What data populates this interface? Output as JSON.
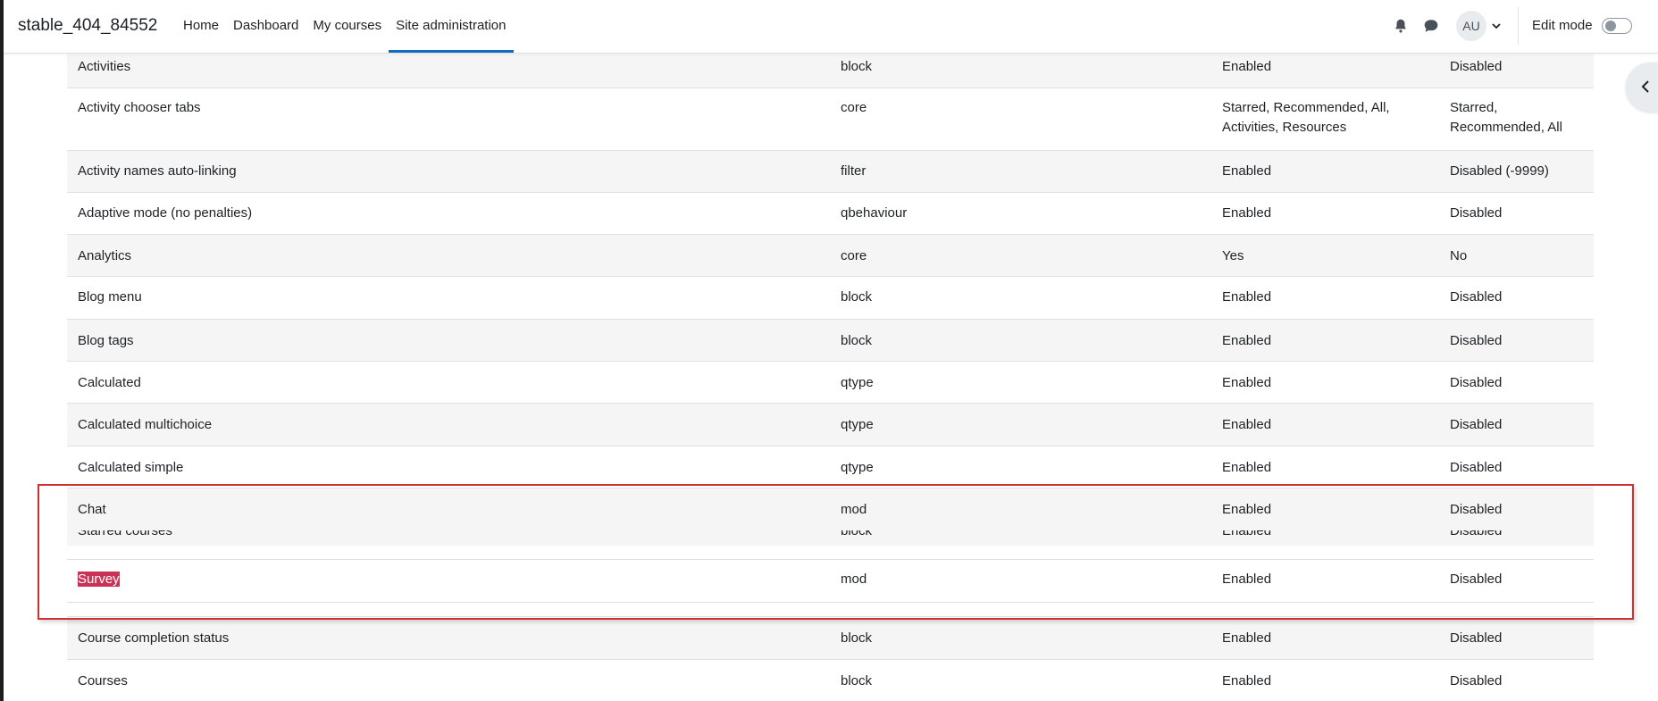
{
  "site": {
    "title": "stable_404_84552"
  },
  "nav": {
    "links": [
      "Home",
      "Dashboard",
      "My courses",
      "Site administration"
    ],
    "active_index": 3
  },
  "user": {
    "initials": "AU"
  },
  "edit_mode": {
    "label": "Edit mode",
    "enabled": false
  },
  "colors": {
    "accent": "#0f6cbf",
    "highlight": "#ca3157",
    "outline": "#d32f2f"
  },
  "table": {
    "rows": [
      {
        "name": "Activities",
        "type": "block",
        "value": "Enabled",
        "default": "Disabled"
      },
      {
        "name": "Activity chooser tabs",
        "type": "core",
        "value": "Starred, Recommended, All, Activities, Resources",
        "default": "Starred, Recommended, All"
      },
      {
        "name": "Activity names auto-linking",
        "type": "filter",
        "value": "Enabled",
        "default": "Disabled (-9999)"
      },
      {
        "name": "Adaptive mode (no penalties)",
        "type": "qbehaviour",
        "value": "Enabled",
        "default": "Disabled"
      },
      {
        "name": "Analytics",
        "type": "core",
        "value": "Yes",
        "default": "No"
      },
      {
        "name": "Blog menu",
        "type": "block",
        "value": "Enabled",
        "default": "Disabled"
      },
      {
        "name": "Blog tags",
        "type": "block",
        "value": "Enabled",
        "default": "Disabled"
      },
      {
        "name": "Calculated",
        "type": "qtype",
        "value": "Enabled",
        "default": "Disabled"
      },
      {
        "name": "Calculated multichoice",
        "type": "qtype",
        "value": "Enabled",
        "default": "Disabled"
      },
      {
        "name": "Calculated simple",
        "type": "qtype",
        "value": "Enabled",
        "default": "Disabled"
      }
    ],
    "overlay_rows": [
      {
        "name": "Chat",
        "type": "mod",
        "value": "Enabled",
        "default": "Disabled"
      },
      {
        "name": "Starred courses",
        "type": "block",
        "value": "Enabled",
        "default": "Disabled"
      },
      {
        "name": "Survey",
        "type": "mod",
        "value": "Enabled",
        "default": "Disabled"
      }
    ],
    "bottom_rows": [
      {
        "name": "Course completion status",
        "type": "block",
        "value": "Enabled",
        "default": "Disabled"
      },
      {
        "name": "Courses",
        "type": "block",
        "value": "Enabled",
        "default": "Disabled"
      }
    ]
  }
}
